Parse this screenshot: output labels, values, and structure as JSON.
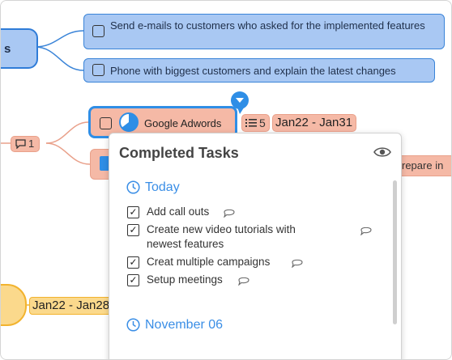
{
  "root": {
    "label": "s"
  },
  "tasks_top": [
    {
      "text": "Send e-mails to customers who asked for the implemented features"
    },
    {
      "text": "Phone with biggest customers and explain the latest changes"
    }
  ],
  "adwords": {
    "label": "Google Adwords",
    "subtask_count": "5",
    "date_range": "Jan22 - Jan31",
    "comment_count": "1",
    "partial_right_text": "repare in"
  },
  "bottom_node": {
    "date_range": "Jan22 - Jan28"
  },
  "popup": {
    "title": "Completed Tasks",
    "sections": [
      {
        "title": "Today",
        "items": [
          {
            "text": "Add call outs"
          },
          {
            "text": "Create new video tutorials with newest features"
          },
          {
            "text": "Creat multiple campaigns"
          },
          {
            "text": "Setup meetings"
          }
        ]
      },
      {
        "title": "November 06"
      }
    ]
  },
  "colors": {
    "blue_node": "#a9c8f3",
    "blue_border": "#2f7cd8",
    "salmon_node": "#f5b9a6",
    "yellow_node": "#fbd98c",
    "accent": "#3a8ee6"
  }
}
